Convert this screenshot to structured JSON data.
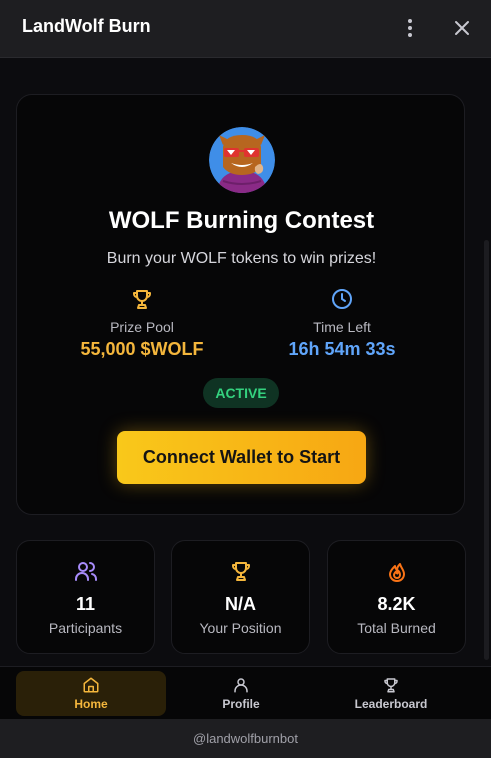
{
  "window": {
    "title": "LandWolf Burn",
    "menu_icon": "more-vertical-icon",
    "close_icon": "close-icon"
  },
  "contest": {
    "avatar_icon": "wolf-avatar-icon",
    "title": "WOLF Burning Contest",
    "subtitle": "Burn your WOLF tokens to win prizes!",
    "prize_pool": {
      "icon": "trophy-icon",
      "label": "Prize Pool",
      "value": "55,000 $WOLF"
    },
    "time_left": {
      "icon": "clock-icon",
      "label": "Time Left",
      "value": "16h 54m 33s"
    },
    "status_badge": "ACTIVE",
    "connect_button": "Connect Wallet to Start"
  },
  "stats": [
    {
      "icon": "users-icon",
      "value": "11",
      "label": "Participants"
    },
    {
      "icon": "trophy-icon",
      "value": "N/A",
      "label": "Your Position"
    },
    {
      "icon": "flame-icon",
      "value": "8.2K",
      "label": "Total Burned"
    }
  ],
  "nav": [
    {
      "icon": "home-icon",
      "label": "Home",
      "active": true
    },
    {
      "icon": "user-icon",
      "label": "Profile",
      "active": false
    },
    {
      "icon": "trophy-icon",
      "label": "Leaderboard",
      "active": false
    }
  ],
  "footer": {
    "bot_handle": "@landwolfburnbot"
  },
  "colors": {
    "accent": "#f4b63c",
    "time": "#60a5fa",
    "active": "#34d27f",
    "users": "#a78bfa",
    "flame": "#f97316"
  }
}
